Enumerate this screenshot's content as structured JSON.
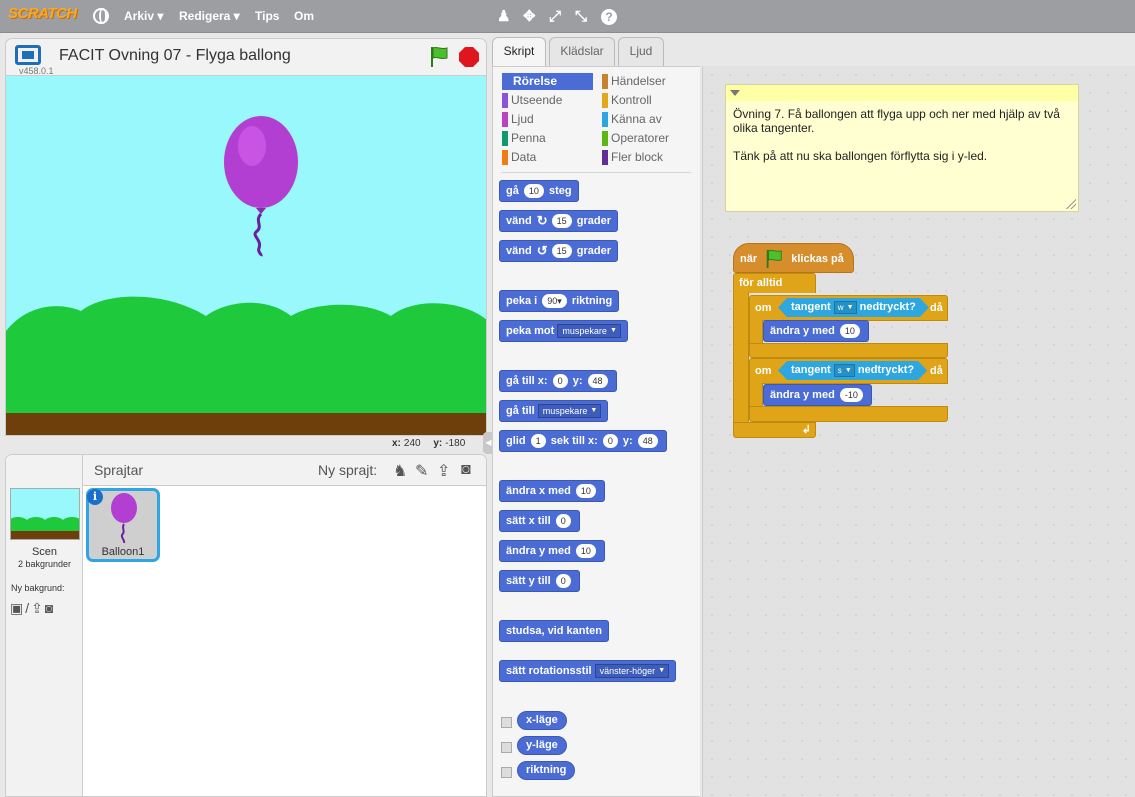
{
  "menubar": {
    "logo": "SCRATCH",
    "items": [
      "Arkiv ▾",
      "Redigera ▾",
      "Tips",
      "Om"
    ],
    "tools": [
      "♟",
      "✥",
      "⤢",
      "⤡",
      "?"
    ]
  },
  "stage": {
    "title": "FACIT Ovning 07 - Flyga ballong",
    "version": "v458.0.1",
    "x_label": "x:",
    "x_value": "240",
    "y_label": "y:",
    "y_value": "-180"
  },
  "sprites": {
    "header": "Sprajtar",
    "new_sprite": "Ny sprajt:",
    "scene_name": "Scen",
    "scene_backdrops": "2 bakgrunder",
    "new_backdrop": "Ny bakgrund:",
    "sprite_name": "Balloon1"
  },
  "tabs": [
    "Skript",
    "Klädslar",
    "Ljud"
  ],
  "categories": {
    "left": [
      {
        "label": "Rörelse",
        "color": "#4a6cd4",
        "active": true
      },
      {
        "label": "Utseende",
        "color": "#8a55d7"
      },
      {
        "label": "Ljud",
        "color": "#bb42c3"
      },
      {
        "label": "Penna",
        "color": "#0e9a6c"
      },
      {
        "label": "Data",
        "color": "#ee7d16"
      }
    ],
    "right": [
      {
        "label": "Händelser",
        "color": "#c88330"
      },
      {
        "label": "Kontroll",
        "color": "#e1a91a"
      },
      {
        "label": "Känna av",
        "color": "#2ca5e2"
      },
      {
        "label": "Operatorer",
        "color": "#5cb712"
      },
      {
        "label": "Fler block",
        "color": "#632d99"
      }
    ]
  },
  "palette": {
    "go_steps": {
      "a": "gå",
      "v": "10",
      "b": "steg"
    },
    "turn_right": {
      "a": "vänd",
      "v": "15",
      "b": "grader"
    },
    "turn_left": {
      "a": "vänd",
      "v": "15",
      "b": "grader"
    },
    "point_dir": {
      "a": "peka i",
      "v": "90▾",
      "b": "riktning"
    },
    "point_towards": {
      "a": "peka mot",
      "dd": "muspekare"
    },
    "goto_xy": {
      "a": "gå till x:",
      "x": "0",
      "b": "y:",
      "y": "48"
    },
    "goto": {
      "a": "gå till",
      "dd": "muspekare"
    },
    "glide": {
      "a": "glid",
      "s": "1",
      "b": "sek till x:",
      "x": "0",
      "c": "y:",
      "y": "48"
    },
    "change_x": {
      "a": "ändra x med",
      "v": "10"
    },
    "set_x": {
      "a": "sätt x till",
      "v": "0"
    },
    "change_y": {
      "a": "ändra y med",
      "v": "10"
    },
    "set_y": {
      "a": "sätt y till",
      "v": "0"
    },
    "bounce": "studsa, vid kanten",
    "rotation": {
      "a": "sätt rotationsstil",
      "dd": "vänster-höger"
    },
    "reporters": [
      "x-läge",
      "y-läge",
      "riktning"
    ]
  },
  "comment": "Övning 7. Få ballongen att flyga upp och ner med hjälp av två olika tangenter.\n\nTänk på att nu ska ballongen förflytta sig i y-led.",
  "script": {
    "hat_a": "när",
    "hat_b": "klickas på",
    "forever": "för alltid",
    "if1": {
      "om": "om",
      "a": "tangent",
      "key": "w",
      "b": "nedtryckt?",
      "da": "då",
      "change_a": "ändra y med",
      "change_v": "10"
    },
    "if2": {
      "om": "om",
      "a": "tangent",
      "key": "s",
      "b": "nedtryckt?",
      "da": "då",
      "change_a": "ändra y med",
      "change_v": "-10"
    }
  },
  "colors": {
    "motion": "#4a6cd4",
    "events": "#d68d2b",
    "control": "#e0a419",
    "sensing": "#2ea7e1",
    "stage_sky": "#99f8fb",
    "hills": "#1fc93c",
    "ground": "#6e3f0b",
    "balloon": "#b23ed2"
  }
}
